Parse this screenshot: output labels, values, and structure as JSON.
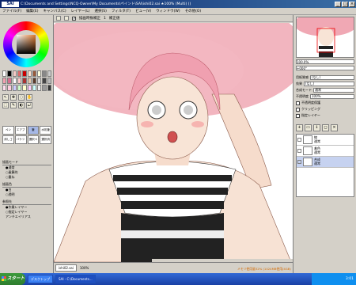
{
  "window": {
    "app_logo": "SAI",
    "title": "C:\\Documents and Settings\\NCQ-Owner\\My Documents\\ペイント\\SAI\\ishi02.sai ★100% (Multi) ()",
    "minimize": "_",
    "maximize": "□",
    "close": "×"
  },
  "menu": [
    "ファイル(F)",
    "編集(E)",
    "キャンバス(C)",
    "レイヤー(L)",
    "選択(S)",
    "フィルタ(T)",
    "ビュー(V)",
    "ウィンドウ(W)",
    "その他(O)"
  ],
  "toolbar": {
    "check_label": "✓",
    "option_label": "描画時振補正",
    "stabilizer": "1",
    "option2": "補正値"
  },
  "tools": [
    "↖",
    "✥",
    "◌",
    "✋",
    "⬚",
    "✎",
    "◐",
    "⤾"
  ],
  "brushes": [
    "ペン",
    "エアブラシ",
    "筆",
    "水彩筆",
    "消しゴム",
    "バケツ",
    "選択ペン",
    "選択消"
  ],
  "brush_options": {
    "header1": "描画モード",
    "opts1": [
      "●通常",
      "○乗算的",
      "○重ね"
    ],
    "header2": "描画色",
    "opts2": [
      "●白",
      "○透明"
    ],
    "header3": "参照先",
    "opts3": [
      "●作業レイヤー",
      "○指定レイヤー"
    ],
    "antialias": "アンチエイリアス"
  },
  "navigator": {
    "zoom_label": "100.0%",
    "angle_label": "+000°"
  },
  "layer_props": {
    "paper_texture": "用紙質感",
    "texture_val": "(なし)",
    "effect": "効果",
    "effect_val": "(なし)",
    "mode": "合成モード",
    "mode_val": "通常",
    "opacity": "不透明度",
    "opacity_val": "100%",
    "protect": "不透明度保護",
    "clip": "クリッピング",
    "ref": "指定レイヤー"
  },
  "layers": [
    {
      "name": "線",
      "mode": "通常",
      "opacity": "100%"
    },
    {
      "name": "着色",
      "mode": "通常",
      "opacity": "100%"
    },
    {
      "name": "合成",
      "mode": "通常",
      "opacity": "100%"
    }
  ],
  "canvas_tab": "ishi02.sai",
  "canvas_zoom": "100%",
  "taskbar": {
    "start": "スタート",
    "tasks": [
      "デスクトップ",
      "SAI - C:\\Documents..."
    ],
    "time": "3:01"
  },
  "notice": "メモリ使用量32% (1024MB使用/4GB)"
}
